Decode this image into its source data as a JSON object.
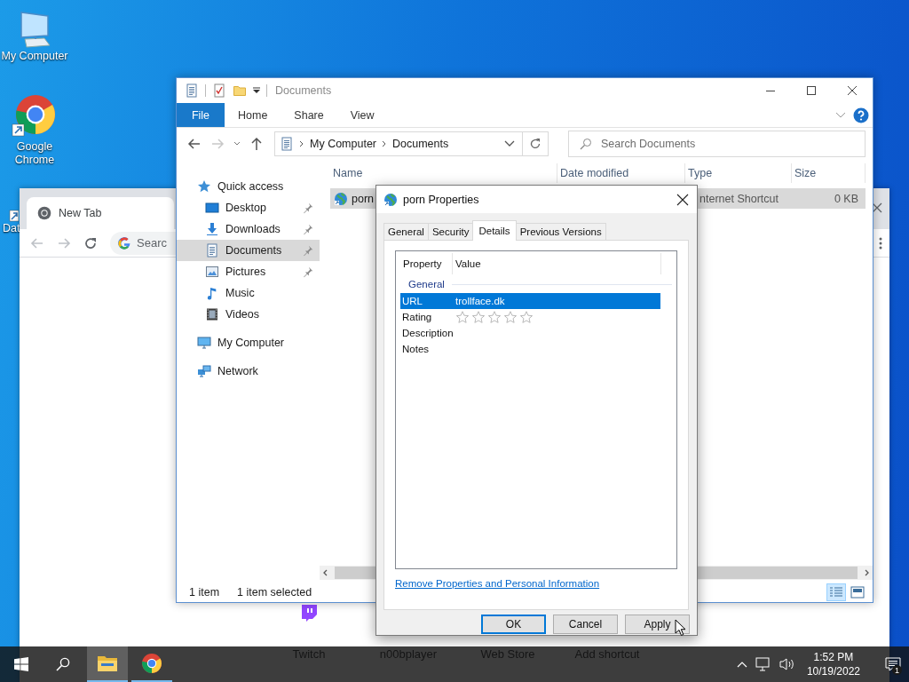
{
  "desktop_icons": [
    {
      "label": "My Computer",
      "kind": "computer"
    },
    {
      "label": "Google Chrome",
      "kind": "browser"
    },
    {
      "label": "Dat",
      "kind": "shortcut"
    }
  ],
  "browser_window": {
    "tab": "New Tab",
    "omnibox_text": "Searc",
    "shortcuts": [
      {
        "label": "Twitch",
        "kind": "chat"
      },
      {
        "label": "n00bplayer"
      },
      {
        "label": "Web Store"
      },
      {
        "label": "Add shortcut"
      }
    ]
  },
  "explorer": {
    "title": "Documents",
    "ribbon_tabs": [
      {
        "label": "File",
        "kind": "menu"
      },
      {
        "label": "Home",
        "kind": "tab"
      },
      {
        "label": "Share",
        "kind": "tab"
      },
      {
        "label": "View",
        "kind": "tab"
      }
    ],
    "forward_disabled": true,
    "breadcrumb": [
      "My Computer",
      "Documents"
    ],
    "search": {
      "placeholder": "Search Documents"
    },
    "nav_items": [
      {
        "label": "Quick access",
        "kind": "star",
        "selected": false,
        "children": [
          {
            "label": "Desktop",
            "kind": "desktop",
            "selected": false,
            "pinned": true
          },
          {
            "label": "Downloads",
            "kind": "download",
            "selected": false,
            "pinned": true
          },
          {
            "label": "Documents",
            "kind": "document",
            "selected": true,
            "pinned": true
          },
          {
            "label": "Pictures",
            "kind": "picture",
            "selected": false,
            "pinned": true
          },
          {
            "label": "Music",
            "kind": "music",
            "selected": false,
            "pinned": false
          },
          {
            "label": "Videos",
            "kind": "video",
            "selected": false,
            "pinned": false
          }
        ]
      },
      {
        "label": "My Computer",
        "kind": "computer",
        "selected": false
      },
      {
        "label": "Network",
        "kind": "network",
        "selected": false
      }
    ],
    "columns": [
      "Name",
      "Date modified",
      "Type",
      "Size"
    ],
    "rows": [
      {
        "name": "porn",
        "type": "nternet Shortcut",
        "size": "0 KB",
        "selected": true
      }
    ],
    "status": [
      "1 item",
      "1 item selected"
    ],
    "views": [
      {
        "kind": "details",
        "selected": true
      },
      {
        "kind": "large",
        "selected": false
      }
    ]
  },
  "dialog": {
    "title": "porn Properties",
    "tabs": [
      {
        "label": "General",
        "selected": false
      },
      {
        "label": "Security",
        "selected": false
      },
      {
        "label": "Details",
        "selected": true
      },
      {
        "label": "Previous Versions",
        "selected": false
      }
    ],
    "columns": [
      "Property",
      "Value"
    ],
    "group": "General",
    "properties": [
      {
        "name": "URL",
        "kind": "text",
        "value": "trollface.dk",
        "selected": true
      },
      {
        "name": "Rating",
        "kind": "stars",
        "stars": 0,
        "selected": false
      },
      {
        "name": "Description",
        "kind": "text",
        "selected": false
      },
      {
        "name": "Notes",
        "kind": "text",
        "selected": false
      }
    ],
    "link": "Remove Properties and Personal Information",
    "buttons": [
      {
        "label": "OK",
        "default": true
      },
      {
        "label": "Cancel",
        "default": false
      },
      {
        "label": "Apply",
        "default": false
      }
    ]
  },
  "taskbar": {
    "apps": [
      {
        "kind": "folder",
        "active": true
      },
      {
        "kind": "browser",
        "active": false
      }
    ],
    "time": "1:52 PM",
    "date": "10/19/2022",
    "notifications": "1"
  }
}
